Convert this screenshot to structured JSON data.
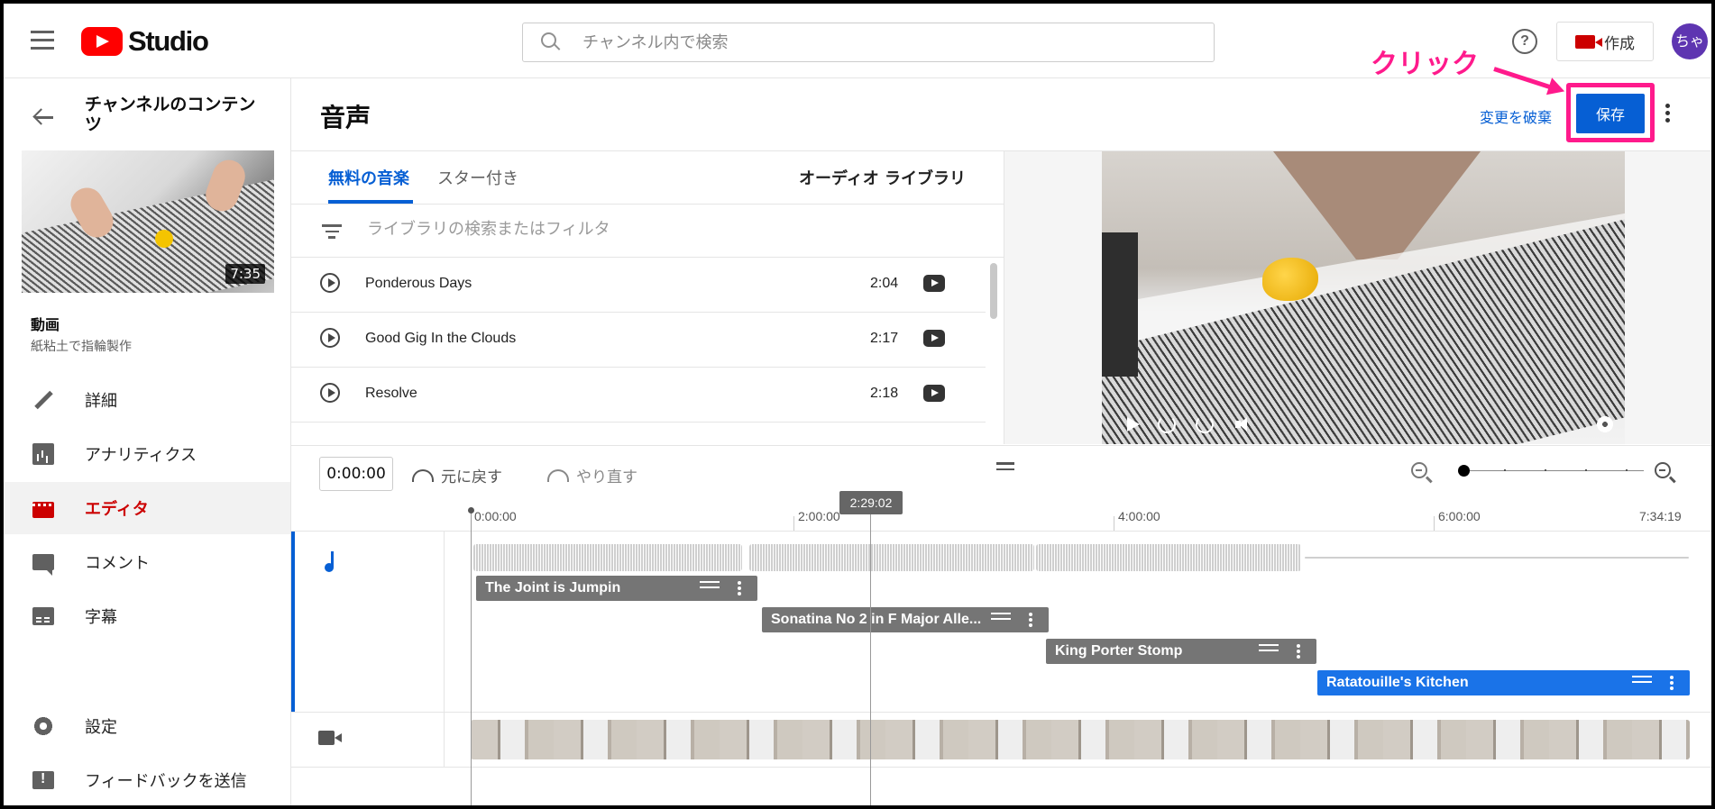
{
  "topbar": {
    "app_name": "Studio",
    "search_placeholder": "チャンネル内で検索",
    "help": "?",
    "create_label": "作成",
    "avatar_label": "ちゃ"
  },
  "sidebar": {
    "channel_title": "チャンネルのコンテンツ",
    "thumbnail_duration": "7:35",
    "video_label": "動画",
    "video_title": "紙粘土で指輪製作",
    "nav": [
      {
        "label": "詳細",
        "icon": "pencil-icon"
      },
      {
        "label": "アナリティクス",
        "icon": "analytics-icon"
      },
      {
        "label": "エディタ",
        "icon": "editor-icon",
        "active": true
      },
      {
        "label": "コメント",
        "icon": "comment-icon"
      },
      {
        "label": "字幕",
        "icon": "subtitles-icon"
      },
      {
        "label": "設定",
        "icon": "gear-icon"
      },
      {
        "label": "フィードバックを送信",
        "icon": "feedback-icon"
      }
    ]
  },
  "header": {
    "title": "音声",
    "discard_label": "変更を破棄",
    "save_label": "保存"
  },
  "annotation": {
    "text": "クリック",
    "color": "#ff1a8c"
  },
  "library": {
    "tabs": [
      "無料の音楽",
      "スター付き"
    ],
    "active_tab": "無料の音楽",
    "library_label": "オーディオ ライブラリ",
    "filter_placeholder": "ライブラリの検索またはフィルタ",
    "tracks": [
      {
        "name": "Ponderous Days",
        "duration": "2:04"
      },
      {
        "name": "Good Gig In the Clouds",
        "duration": "2:17"
      },
      {
        "name": "Resolve",
        "duration": "2:18"
      }
    ]
  },
  "timeline": {
    "current_time": "0:00:00",
    "undo_label": "元に戻す",
    "redo_label": "やり直す",
    "playhead_time": "2:29:02",
    "ruler_ticks": [
      "0:00:00",
      "2:00:00",
      "4:00:00",
      "6:00:00",
      "7:34:19"
    ],
    "audio_clips": [
      {
        "name": "The Joint is Jumpin"
      },
      {
        "name": "Sonatina No 2 in F Major Alle..."
      },
      {
        "name": "King Porter Stomp"
      },
      {
        "name": "Ratatouille's Kitchen",
        "selected": true
      }
    ]
  },
  "colors": {
    "accent": "#065fd4",
    "brand_red": "#ff0000",
    "selected_clip": "#1a73e8"
  }
}
